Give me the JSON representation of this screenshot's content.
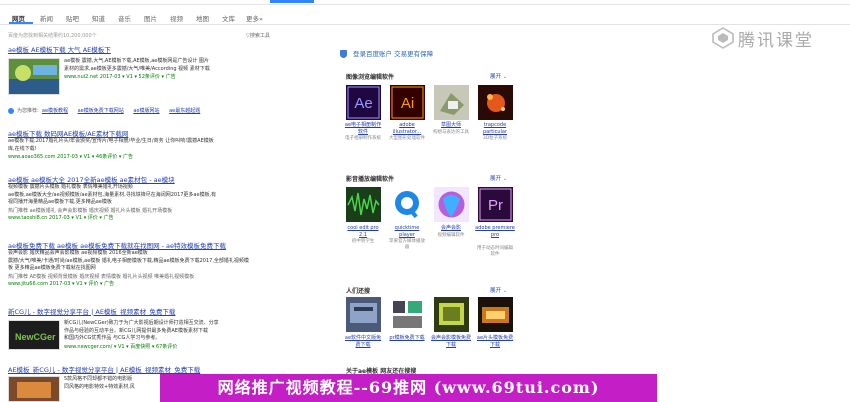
{
  "tabs": [
    "网页",
    "新闻",
    "贴吧",
    "知道",
    "音乐",
    "图片",
    "视频",
    "地图",
    "文库",
    "更多»"
  ],
  "result_count": "百度为您找到相关结果约10,200,000个",
  "search_tools": "搜索工具",
  "results": [
    {
      "title": "ae模板 AE模板下载 大气 AE模板下",
      "desc1": "ae模板 震撼,大气,AE模板下载,AE模板,ae模板网是广告设计 图片",
      "desc2": "素材的需求,ae模板更多震撼/大气/唯美/According 视频 素材下载",
      "url": "www.nui2.net  2017-03  ▾  V1  ▾  52条评价  ▾  广告"
    },
    {
      "title": "ae模板下载 数码网AE模板/AE素材下载网",
      "desc1": "ae模板下载,2017婚礼片头/年会颁奖/宣传片/电子相册/毕业/生日/商务 让你叫响!震撼AE模板",
      "desc2": "库,在线下载!",
      "url": "www.aoao365.com  2017-03  ▾  V1  ▾  46条评价  ▾  广告"
    },
    {
      "title": "ae模板 ae模板大全 2017全新ae模板 ae素材包 - ae模块",
      "desc1": "视频模板  震撼片头模板  婚礼模板  表情唯美婚礼开场视频",
      "desc2": "ae模板,ae模板大全/ae视频模板/ae素材包,海量素材,寻找铁锋尽在海阔网2017更多ae模板,有",
      "desc3": "视同播开海量精品ae模板下载,更多精品ae模板",
      "line": "热门推荐  ae模板婚礼  会声会影模板  婚庆视频  婚礼片头模板  婚礼开场模板",
      "url": "www.taoshi8.cn  2017-03  ▾  V1  ▾  评价  ▾  广告"
    },
    {
      "title": "ae模板免费下载 ae模板 ae模板免费下载就在找图网 - ae特效模板免费下载",
      "desc1": "会声会影  婚庆精品会声会影模板  ae视频模板  2016全新ae模板",
      "desc2": "震撼/大气/唯美/卡通/时尚/ae模板,ae模板 婚礼电子相册模板下载,精品ae模板免费下载2017,全部婚礼视频模",
      "desc3": "板 更多精品ae模板免费下载就在找图网",
      "line": "热门推荐  AE模板  视频背景模板  婚庆视频  表情模板  婚礼片头视频  唯美婚礼视频模板",
      "url": "www.jitu66.com  2017-03  ▾  V1  ▾  评价  ▾  广告"
    },
    {
      "title": "新CG儿 - 数字视觉分享平台 | AE模板_视频素材_免费下载",
      "desc1": "新CG儿(NewCGer)致力于为广大影视后期设计师打造相互交流、分享",
      "desc2": "作品与经验的互动平台。新CG儿网提供最多免费AE模板素材下载",
      "desc3": "和国内外CG优秀作品 与CG人学习与参考。",
      "url": "www.newcger.com/  ▾  V1  ▾  百度快照  ▾  67条评价"
    },
    {
      "title": "AE模板_新CG儿 - 数字视觉分享平台 | AE模板_视频素材_免费下载",
      "desc1": "5款风格不同却都不错的电影版",
      "desc2": "同风格的电影特效+特效素材,风"
    }
  ],
  "hint": {
    "label": "为您推荐:",
    "links": [
      "ae模板教程",
      "ae模板免费下载网站",
      "ae模版网站",
      "ae最东越起题"
    ]
  },
  "promo": "登录百度账户 交易更有保障",
  "sections": [
    {
      "title": "图像浏览编辑软件",
      "more": "展开",
      "items": [
        {
          "label": "ae电子相册制作软件",
          "sub": "电子相册制作系统",
          "glyph": "Ae"
        },
        {
          "label": "adobe illustrator...",
          "sub": "大型图形处理软件",
          "glyph": "Ai"
        },
        {
          "label": "草图大师",
          "sub": "构想与表达的工具",
          "glyph": ""
        },
        {
          "label": "trapcode particular",
          "sub": "3D粒子系统",
          "glyph": ""
        }
      ]
    },
    {
      "title": "影音播放编辑软件",
      "more": "展开",
      "items": [
        {
          "label": "cool edit pro 2.1",
          "sub": "初中到学生",
          "glyph": ""
        },
        {
          "label": "quicktime player",
          "sub": "苹果官方媒体播放器",
          "glyph": ""
        },
        {
          "label": "会声会影",
          "sub": "视频编辑软件",
          "glyph": ""
        },
        {
          "label": "adobe premiere pro",
          "sub": "用于动态时间编辑软件",
          "glyph": "Pr"
        }
      ]
    },
    {
      "title": "人们还搜",
      "more": "展开",
      "items": [
        {
          "label": "ae软件中文版免费下载",
          "sub": "",
          "glyph": ""
        },
        {
          "label": "pr模板免费下载",
          "sub": "",
          "glyph": ""
        },
        {
          "label": "会声会影模板免费下载",
          "sub": "",
          "glyph": ""
        },
        {
          "label": "ae片头模板免费下载",
          "sub": "",
          "glyph": ""
        }
      ]
    }
  ],
  "bottom_tail": "关于ae模板 网友还在搜搜",
  "watermark": "腾讯课堂",
  "banner": "网络推广视频教程--69推网 (www.69tui.com)",
  "colors": {
    "link": "#2440b3",
    "url": "#008000",
    "banner": "#c41ec7",
    "accent": "#3385ff"
  }
}
